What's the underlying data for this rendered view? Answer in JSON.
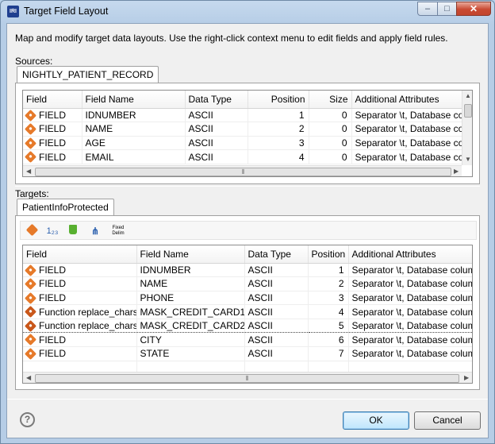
{
  "window": {
    "title": "Target Field Layout",
    "app_icon_text": "IRI",
    "controls": {
      "minimize": "–",
      "maximize": "□",
      "close": "✕"
    }
  },
  "description": "Map and modify target data layouts. Use the right-click context menu to edit fields and apply field rules.",
  "sources": {
    "label": "Sources:",
    "tab": "NIGHTLY_PATIENT_RECORD",
    "columns": [
      "Field",
      "Field Name",
      "Data Type",
      "Position",
      "Size",
      "Additional Attributes"
    ],
    "rows": [
      {
        "field": "FIELD",
        "name": "IDNUMBER",
        "type": "ASCII",
        "position": "1",
        "size": "0",
        "attrs": "Separator \\t, Database colum..."
      },
      {
        "field": "FIELD",
        "name": "NAME",
        "type": "ASCII",
        "position": "2",
        "size": "0",
        "attrs": "Separator \\t, Database colum..."
      },
      {
        "field": "FIELD",
        "name": "AGE",
        "type": "ASCII",
        "position": "3",
        "size": "0",
        "attrs": "Separator \\t, Database colum..."
      },
      {
        "field": "FIELD",
        "name": "EMAIL",
        "type": "ASCII",
        "position": "4",
        "size": "0",
        "attrs": "Separator \\t, Database colum..."
      }
    ]
  },
  "targets": {
    "label": "Targets:",
    "tab": "PatientInfoProtected",
    "toolbar": {
      "add_field_icon": "add-field-icon",
      "renumber_text": "1₂₃",
      "delete_icon": "trash-icon",
      "map_icon": "map-fields-icon",
      "fixed_delim_text": "Fixed Delim"
    },
    "columns": [
      "Field",
      "Field Name",
      "Data Type",
      "Position",
      "Additional Attributes"
    ],
    "rows": [
      {
        "field": "FIELD",
        "name": "IDNUMBER",
        "type": "ASCII",
        "position": "1",
        "attrs": "Separator \\t, Database colum...",
        "kind": "field"
      },
      {
        "field": "FIELD",
        "name": "NAME",
        "type": "ASCII",
        "position": "2",
        "attrs": "Separator \\t, Database colum...",
        "kind": "field"
      },
      {
        "field": "FIELD",
        "name": "PHONE",
        "type": "ASCII",
        "position": "3",
        "attrs": "Separator \\t, Database colum...",
        "kind": "field"
      },
      {
        "field": "Function replace_chars",
        "name": "MASK_CREDIT_CARD1",
        "type": "ASCII",
        "position": "4",
        "attrs": "Separator \\t, Database colum...",
        "kind": "func"
      },
      {
        "field": "Function replace_chars",
        "name": "MASK_CREDIT_CARD2",
        "type": "ASCII",
        "position": "5",
        "attrs": "Separator \\t, Database colum...",
        "kind": "func",
        "selected": true
      },
      {
        "field": "FIELD",
        "name": "CITY",
        "type": "ASCII",
        "position": "6",
        "attrs": "Separator \\t, Database colum...",
        "kind": "field"
      },
      {
        "field": "FIELD",
        "name": "STATE",
        "type": "ASCII",
        "position": "7",
        "attrs": "Separator \\t, Database colum...",
        "kind": "field"
      }
    ]
  },
  "buttons": {
    "ok": "OK",
    "cancel": "Cancel",
    "help": "?"
  },
  "colors": {
    "field_icon": "#e67a2a",
    "titlebar": "#c6d9ee",
    "close_button": "#c94a32"
  }
}
